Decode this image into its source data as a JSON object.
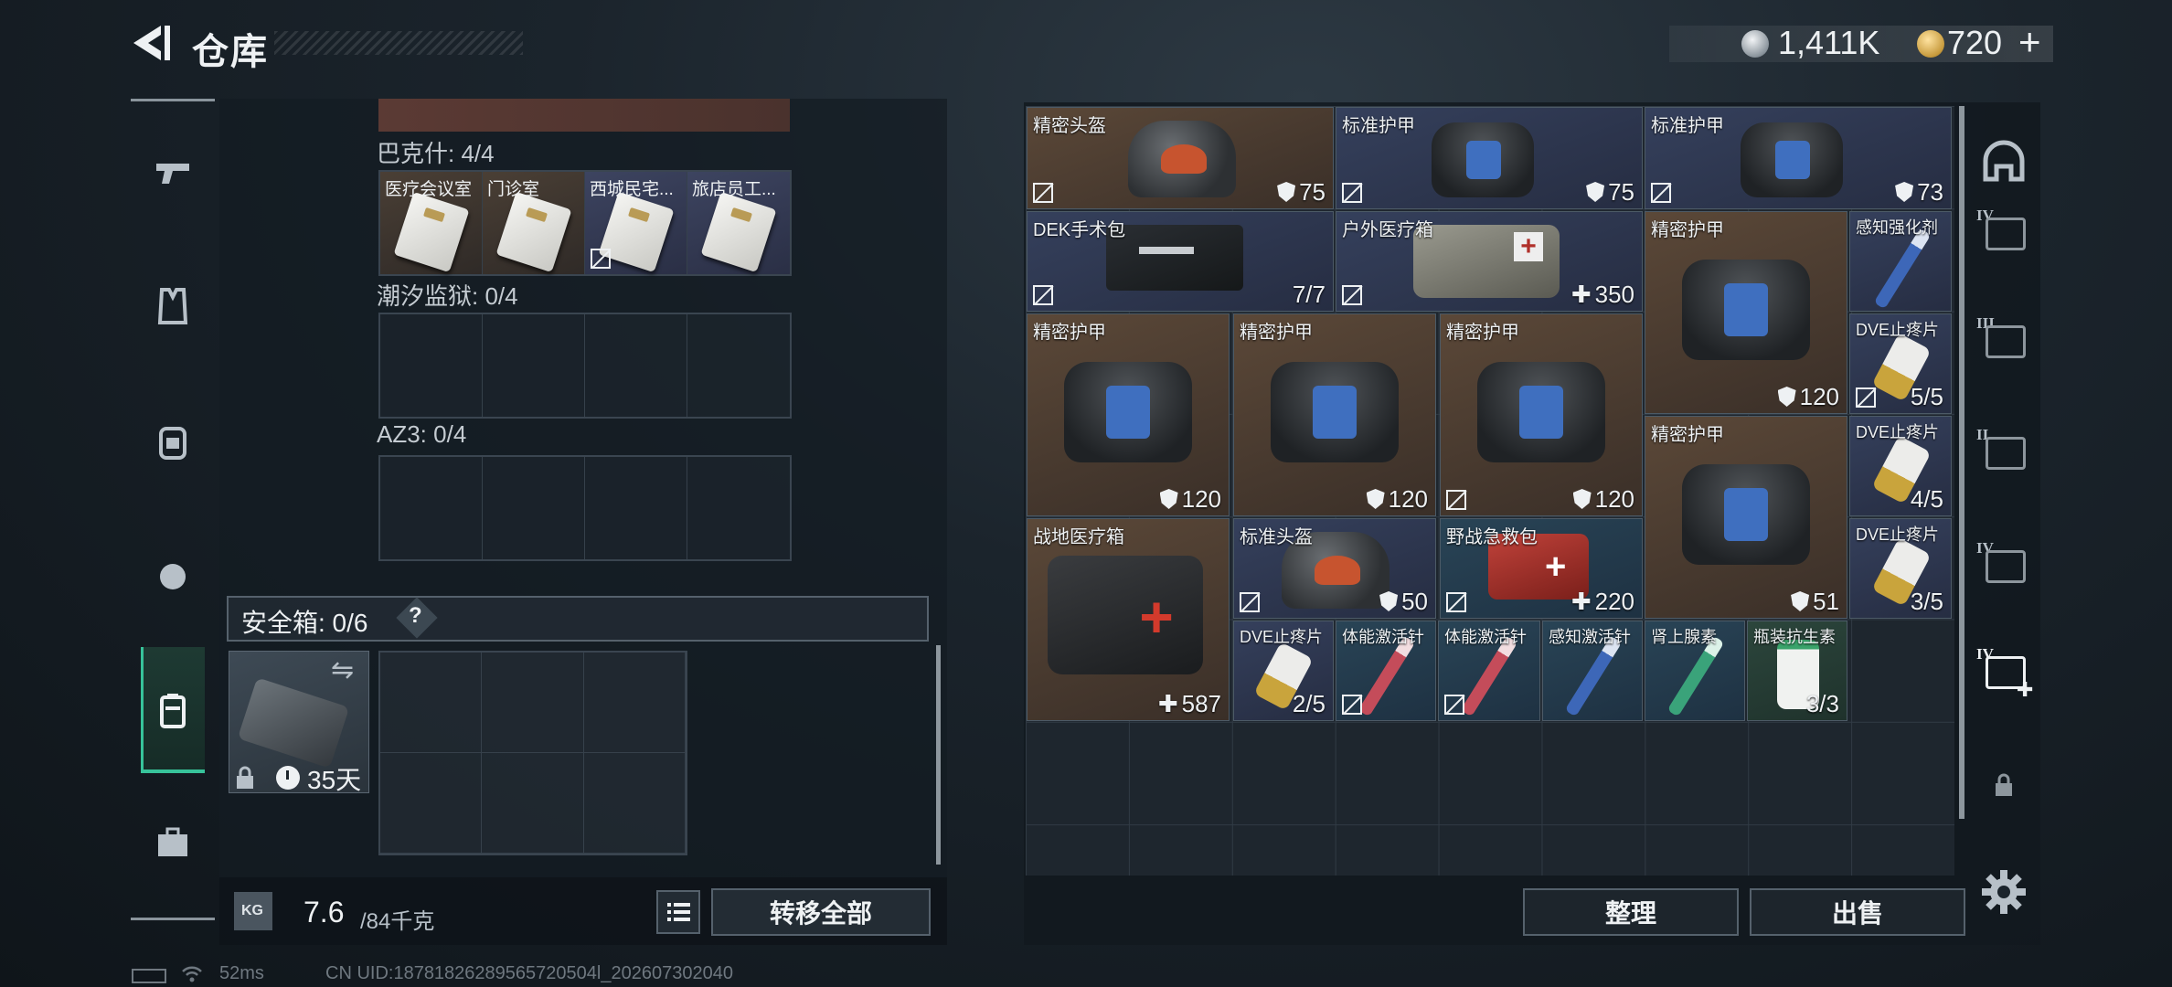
{
  "header": {
    "title": "仓库"
  },
  "currency": {
    "silver": "1,411K",
    "gold": "720",
    "gold_add": "+"
  },
  "keycard_groups": [
    {
      "label": "巴克什: 4/4",
      "slots": [
        "医疗会议室",
        "门诊室",
        "西城民宅...",
        "旅店员工..."
      ]
    },
    {
      "label": "潮汐监狱: 0/4"
    },
    {
      "label": "AZ3: 0/4"
    }
  ],
  "safe_box": {
    "label": "安全箱: 0/6",
    "help": "?",
    "days": "35天"
  },
  "weight": {
    "kg_icon": "KG",
    "current": "7.6",
    "max": "/84千克"
  },
  "buttons": {
    "transfer_all": "转移全部",
    "sort": "整理",
    "sell": "出售"
  },
  "items": {
    "i1": {
      "name": "精密头盔",
      "value": "75"
    },
    "i2": {
      "name": "标准护甲",
      "value": "75"
    },
    "i3": {
      "name": "标准护甲",
      "value": "73"
    },
    "i4": {
      "name": "DEK手术包",
      "value": "7/7"
    },
    "i5": {
      "name": "户外医疗箱",
      "value": "350"
    },
    "i6": {
      "name": "精密护甲",
      "value": "120"
    },
    "i7": {
      "name": "感知强化剂"
    },
    "i8": {
      "name": "精密护甲",
      "value": "120"
    },
    "i9": {
      "name": "精密护甲",
      "value": "120"
    },
    "i10": {
      "name": "精密护甲",
      "value": "120"
    },
    "i11": {
      "name": "DVE止疼片",
      "value": "5/5"
    },
    "i12": {
      "name": "精密护甲",
      "value": "51"
    },
    "i13": {
      "name": "DVE止疼片",
      "value": "4/5"
    },
    "i14": {
      "name": "战地医疗箱",
      "value": "587"
    },
    "i15": {
      "name": "标准头盔",
      "value": "50"
    },
    "i16": {
      "name": "野战急救包",
      "value": "220"
    },
    "i17": {
      "name": "DVE止疼片",
      "value": "3/5"
    },
    "i18": {
      "name": "DVE止疼片",
      "value": "2/5"
    },
    "i19": {
      "name": "体能激活针"
    },
    "i20": {
      "name": "体能激活针"
    },
    "i21": {
      "name": "感知激活针"
    },
    "i22": {
      "name": "肾上腺素"
    },
    "i23": {
      "name": "瓶装抗生素",
      "value": "3/3"
    }
  },
  "right_tabs": [
    "IV",
    "III",
    "II",
    "IV",
    "IV"
  ],
  "status": {
    "ping": "52ms",
    "uid": "CN UID:18781826289565720504l_202607302040"
  }
}
